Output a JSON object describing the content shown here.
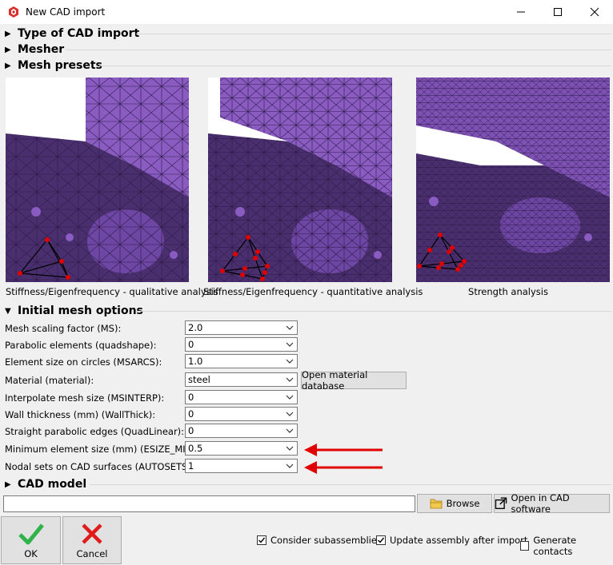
{
  "window": {
    "title": "New CAD import"
  },
  "sections": {
    "type_of_cad_import": "Type of CAD import",
    "mesher": "Mesher",
    "mesh_presets": "Mesh presets",
    "initial_mesh_options": "Initial mesh options",
    "cad_model": "CAD model"
  },
  "presets": [
    {
      "caption": "Stiffness/Eigenfrequency - qualitative analysis"
    },
    {
      "caption": "Stiffness/Eigenfrequency - quantitative analysis"
    },
    {
      "caption": "Strength analysis"
    }
  ],
  "options": [
    {
      "label": "Mesh scaling factor (MS):",
      "value": "2.0"
    },
    {
      "label": "Parabolic elements (quadshape):",
      "value": "0"
    },
    {
      "label": "Element size on circles (MSARCS):",
      "value": "1.0"
    },
    {
      "label": "Material (material):",
      "value": "steel"
    },
    {
      "label": "Interpolate mesh size (MSINTERP):",
      "value": "0"
    },
    {
      "label": "Wall thickness (mm) (WallThick):",
      "value": "0"
    },
    {
      "label": "Straight parabolic edges (QuadLinear):",
      "value": "0"
    },
    {
      "label": "Minimum element size (mm) (ESIZE_MIN):",
      "value": "0.5"
    },
    {
      "label": "Nodal sets on CAD surfaces (AUTOSETS):",
      "value": "1"
    }
  ],
  "buttons": {
    "open_material_db": "Open material database",
    "browse": "Browse",
    "open_in_cad": "Open in CAD software",
    "ok": "OK",
    "cancel": "Cancel"
  },
  "cad_path": {
    "value": ""
  },
  "checkboxes": [
    {
      "label": "Consider subassemblies",
      "checked": true
    },
    {
      "label": "Update assembly after import",
      "checked": true
    },
    {
      "label": "Generate contacts",
      "checked": false
    }
  ],
  "colors": {
    "mesh": "#8a5cc2",
    "mesh_dark": "#4a2f6e",
    "node": "#e00000",
    "ok_green": "#2fb34a",
    "cancel_red": "#e01b1b",
    "arrow": "#e00000"
  }
}
